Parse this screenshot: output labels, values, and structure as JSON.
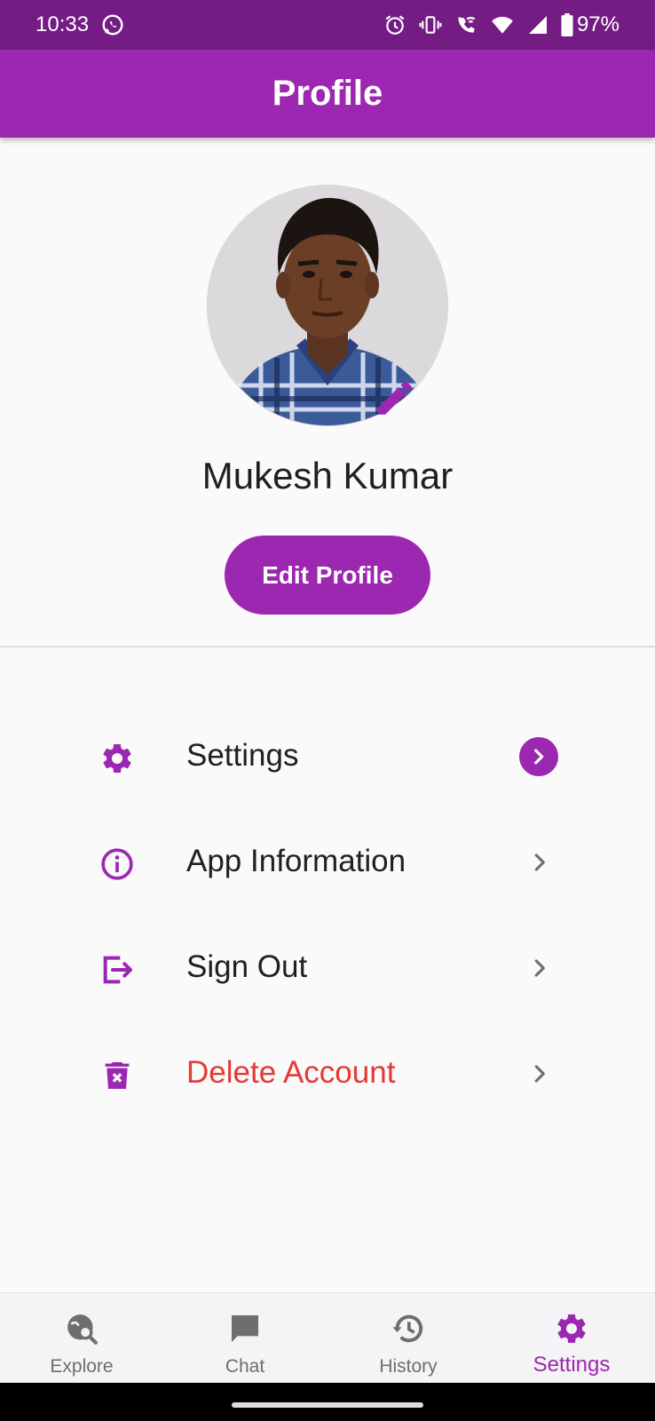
{
  "status_bar": {
    "time": "10:33",
    "battery": "97%",
    "icons": [
      "whatsapp-icon",
      "alarm-icon",
      "vibrate-icon",
      "wifi-call-icon",
      "wifi-icon",
      "signal-icon",
      "battery-icon"
    ]
  },
  "app_bar": {
    "title": "Profile"
  },
  "profile": {
    "name": "Mukesh Kumar",
    "edit_button": "Edit Profile",
    "avatar_icon": "person-photo",
    "edit_avatar_icon": "pencil-icon"
  },
  "menu": {
    "items": [
      {
        "label": "Settings",
        "icon": "gear-icon"
      },
      {
        "label": "App Information",
        "icon": "info-icon"
      },
      {
        "label": "Sign Out",
        "icon": "logout-icon"
      },
      {
        "label": "Delete Account",
        "icon": "trash-icon"
      }
    ]
  },
  "bottom_nav": {
    "items": [
      {
        "label": "Explore",
        "icon": "explore-icon"
      },
      {
        "label": "Chat",
        "icon": "chat-icon"
      },
      {
        "label": "History",
        "icon": "history-icon"
      },
      {
        "label": "Settings",
        "icon": "gear-icon"
      }
    ],
    "active": "Settings"
  },
  "colors": {
    "primary": "#9c27b0",
    "status_bar": "#751c84",
    "danger": "#e53935",
    "background": "#fafafa"
  }
}
